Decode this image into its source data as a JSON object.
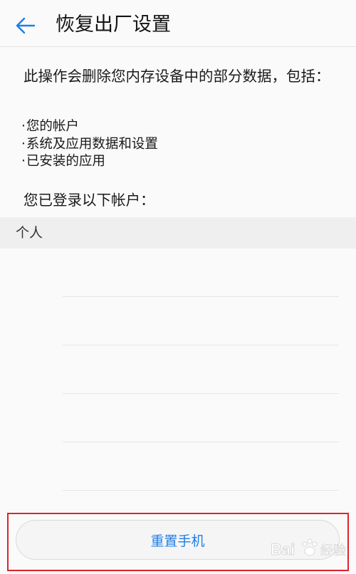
{
  "header": {
    "back_icon": "arrow-left-icon",
    "title": "恢复出厂设置"
  },
  "description": "此操作会删除您内存设备中的部分数据，包括：",
  "items": [
    "您的帐户",
    "系统及应用数据和设置",
    "已安装的应用"
  ],
  "accounts_heading": "您已登录以下帐户：",
  "section": {
    "label": "个人"
  },
  "accounts": [
    {
      "name": ""
    },
    {
      "name": ""
    },
    {
      "name": ""
    },
    {
      "name": ""
    },
    {
      "name": ""
    }
  ],
  "reset_button": {
    "label": "重置手机"
  },
  "watermark": {
    "text": "Bai 经验"
  },
  "colors": {
    "accent": "#1f7ee6",
    "highlight": "#e0232b",
    "background": "#fafafa"
  }
}
